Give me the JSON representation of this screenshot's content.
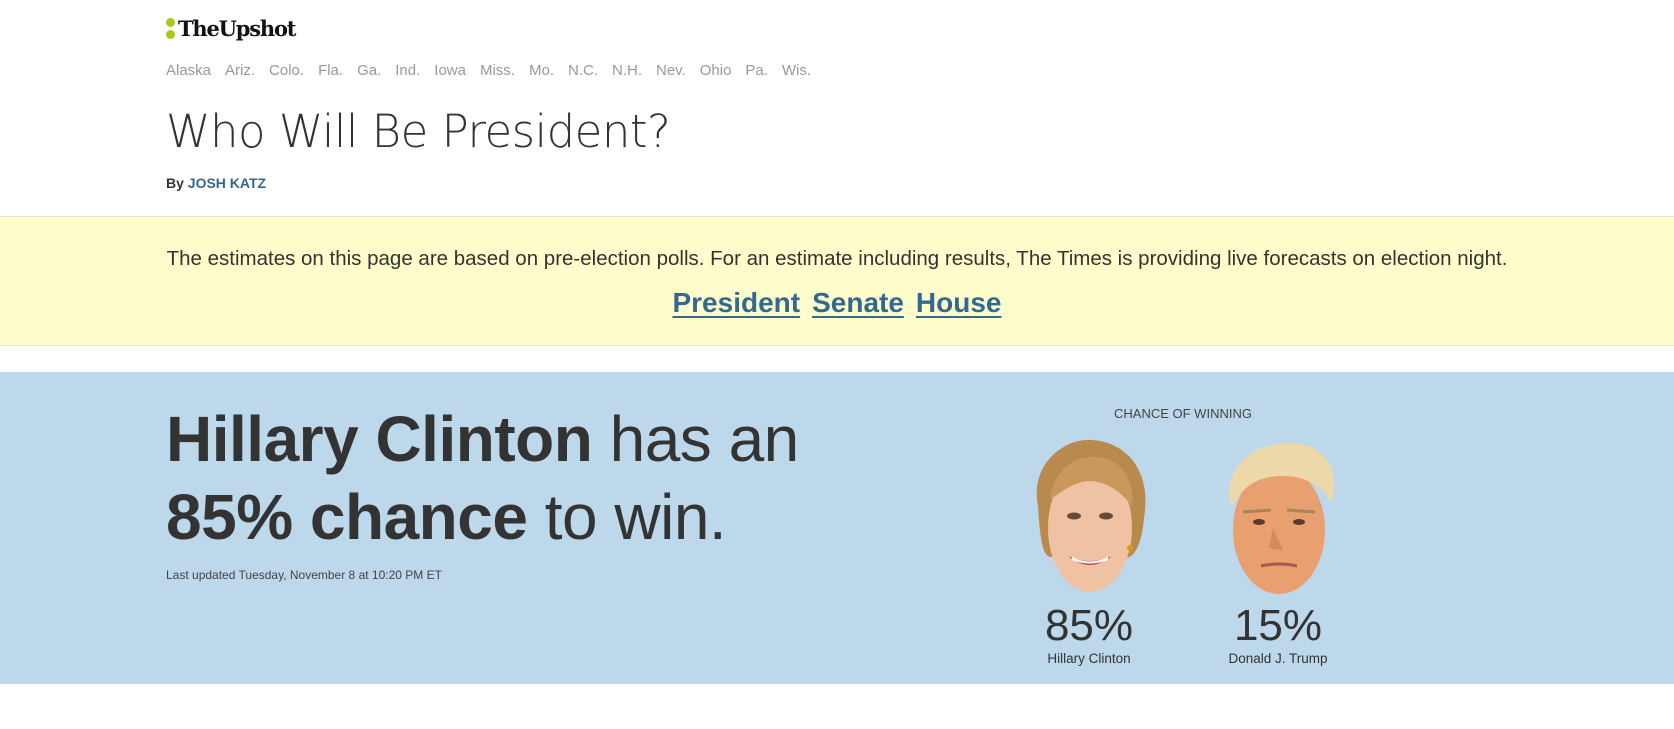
{
  "brand": {
    "logo_text": "TheUpshot",
    "accent_color": "#a7c91e"
  },
  "states": [
    "Alaska",
    "Ariz.",
    "Colo.",
    "Fla.",
    "Ga.",
    "Ind.",
    "Iowa",
    "Miss.",
    "Mo.",
    "N.C.",
    "N.H.",
    "Nev.",
    "Ohio",
    "Pa.",
    "Wis."
  ],
  "article": {
    "title": "Who Will Be President?",
    "byline_prefix": "By",
    "author": "JOSH KATZ"
  },
  "notice": {
    "text": "The estimates on this page are based on pre-election polls. For an estimate including results, The Times is providing live forecasts on election night.",
    "links": {
      "president": "President",
      "senate": "Senate",
      "house": "House"
    },
    "background": "#fffdcc",
    "link_color": "#326891"
  },
  "forecast": {
    "headline_name": "Hillary Clinton",
    "headline_mid": "has an",
    "headline_pct": "85% chance",
    "headline_end": "to win.",
    "updated": "Last updated Tuesday, November 8 at 10:20 PM ET",
    "chance_label": "Chance of winning",
    "background": "#bdd7eb",
    "candidates": [
      {
        "name": "Hillary Clinton",
        "pct": "85%"
      },
      {
        "name": "Donald J. Trump",
        "pct": "15%"
      }
    ]
  }
}
